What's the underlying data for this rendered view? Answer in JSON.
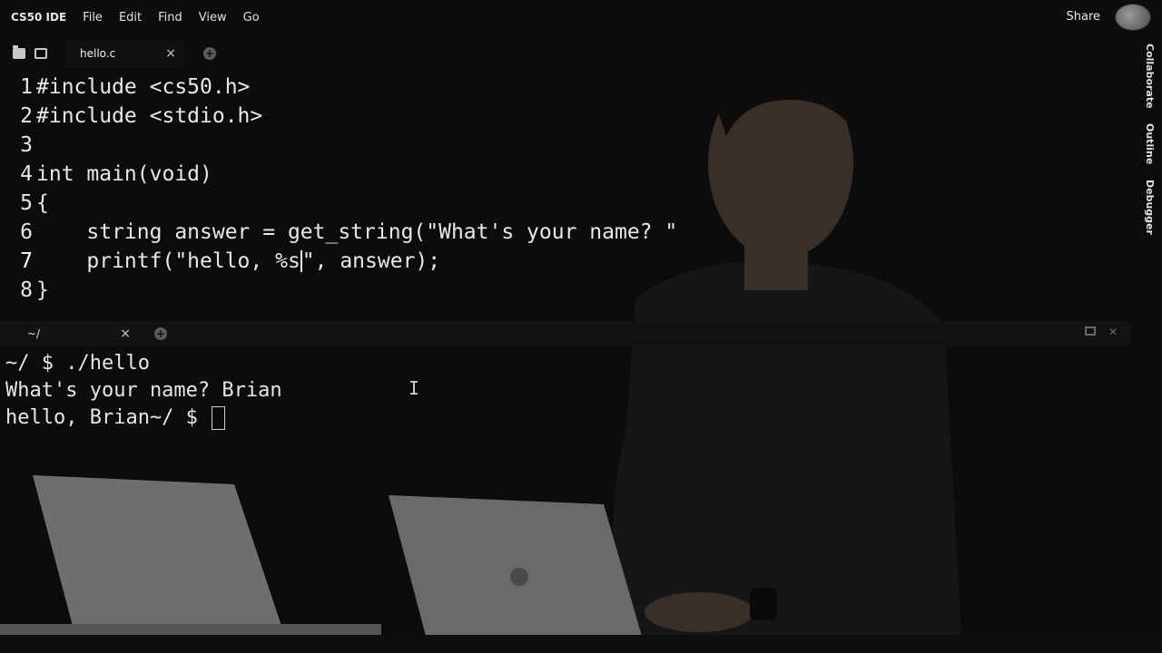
{
  "menubar": {
    "brand": "CS50 IDE",
    "items": [
      "File",
      "Edit",
      "Find",
      "View",
      "Go"
    ],
    "share_label": "Share"
  },
  "editor_tabs": {
    "active_tab": {
      "label": "hello.c",
      "close": "×"
    }
  },
  "editor": {
    "lines": [
      {
        "num": "1",
        "text": "#include <cs50.h>"
      },
      {
        "num": "2",
        "text": "#include <stdio.h>"
      },
      {
        "num": "3",
        "text": ""
      },
      {
        "num": "4",
        "text": "int main(void)"
      },
      {
        "num": "5",
        "text": "{"
      },
      {
        "num": "6",
        "text": "    string answer = get_string(\"What's your name? \""
      },
      {
        "num": "7",
        "text_before": "    printf(\"hello, %s",
        "text_after": "\", answer);"
      },
      {
        "num": "8",
        "text": "}"
      }
    ]
  },
  "right_panel": {
    "labels": [
      "Collaborate",
      "Outline",
      "Debugger"
    ]
  },
  "terminal_tabs": {
    "active_tab": {
      "label": "~/",
      "close": "×"
    }
  },
  "terminal": {
    "lines": [
      "~/ $ ./hello",
      "What's your name? Brian",
      "hello, Brian~/ $ "
    ]
  },
  "icons": {
    "folder": "folder-icon",
    "outline": "outline-icon",
    "plus": "plus-icon",
    "restore": "restore-window-icon",
    "close": "close-icon"
  }
}
